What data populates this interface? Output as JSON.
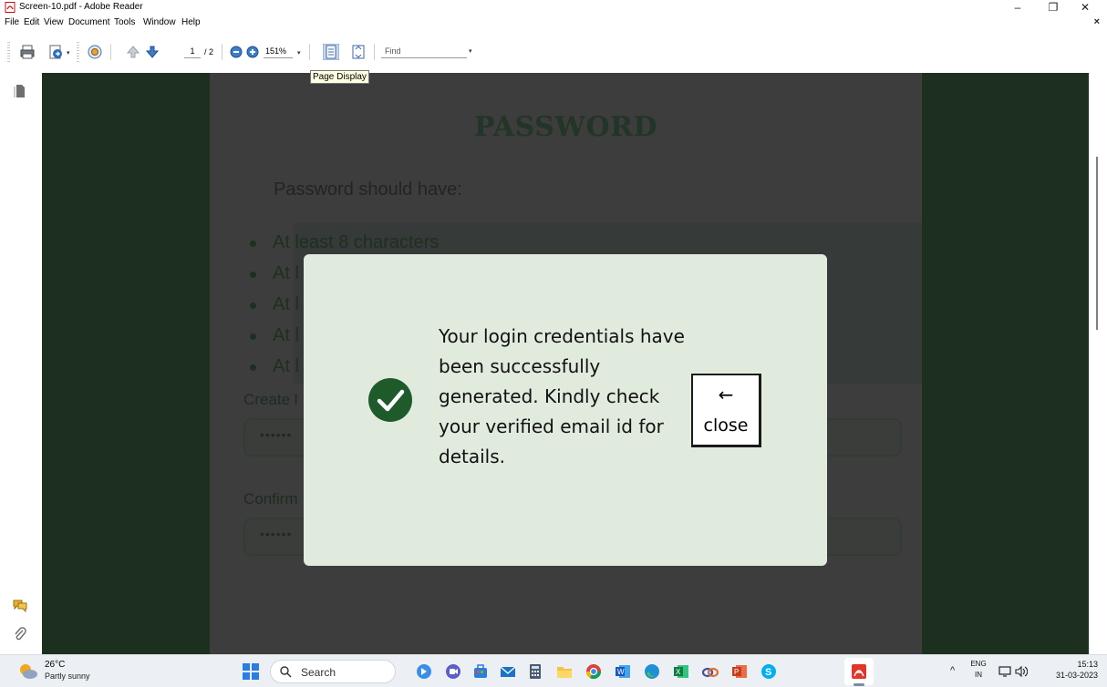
{
  "window": {
    "title": "Screen-10.pdf - Adobe Reader",
    "controls": {
      "minimize": "–",
      "restore": "❐",
      "close": "✕"
    }
  },
  "menubar": {
    "items": [
      "File",
      "Edit",
      "View",
      "Document",
      "Tools",
      "Window",
      "Help"
    ],
    "close_doc": "×"
  },
  "toolbar": {
    "page_current": "1",
    "page_total": "/ 2",
    "zoom": "151%",
    "find_placeholder": "Find",
    "tooltip": "Page Display",
    "icons": [
      "print-icon",
      "export-icon",
      "hand-tool-icon",
      "page-up-icon",
      "page-down-icon",
      "zoom-out-icon",
      "zoom-in-icon",
      "single-page-icon",
      "fit-page-icon"
    ]
  },
  "document": {
    "title": "PASSWORD",
    "subtitle": "Password should have:",
    "requirements": [
      "At least 8 characters",
      "At l",
      "At l",
      "At l",
      "At l"
    ],
    "create_label": "Create l",
    "create_value": "••••••",
    "confirm_label": "Confirm",
    "confirm_value": "••••••"
  },
  "modal": {
    "message": "Your login credentials have been successfully generated. Kindly check your verified email id for details.",
    "close_arrow": "←",
    "close_label": "close",
    "accent": "#1f5a2b"
  },
  "taskbar": {
    "weather_temp": "26°C",
    "weather_desc": "Partly sunny",
    "search_label": "Search",
    "lang_top": "ENG",
    "lang_bottom": "IN",
    "time": "15:13",
    "date": "31-03-2023"
  },
  "colors": {
    "doc_background": "#1d301f",
    "page_background": "#3d3d3d",
    "modal_background": "#e0ebde",
    "check_green": "#1f5a2b"
  }
}
